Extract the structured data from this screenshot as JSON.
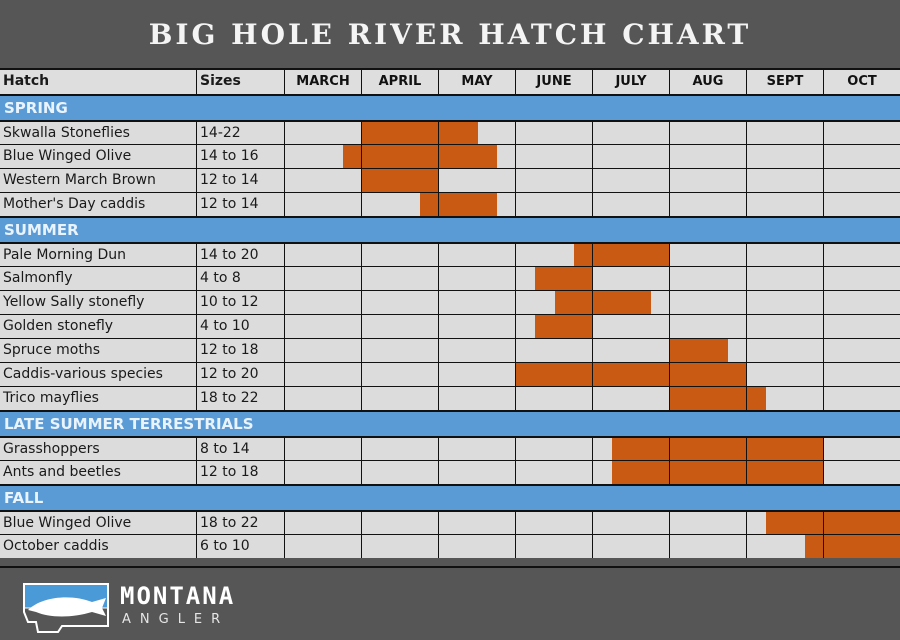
{
  "title": "BIG HOLE RIVER HATCH CHART",
  "headers": {
    "hatch": "Hatch",
    "sizes": "Sizes"
  },
  "brand": {
    "line1": "MONTANA",
    "line2": "ANGLER",
    "logo_icon": "montana-fish-logo"
  },
  "colors": {
    "bar": "#c85a13",
    "section": "#5b9bd5",
    "cell": "#dcdcdc",
    "background": "#565656"
  },
  "chart_data": {
    "type": "table",
    "title": "BIG HOLE RIVER HATCH CHART",
    "months": [
      "MARCH",
      "APRIL",
      "MAY",
      "JUNE",
      "JULY",
      "AUG",
      "SEPT",
      "OCT"
    ],
    "note": "Each hatch has an active period expressed as [start, end] in month units, where 0 = start of MARCH and 8 = end of OCT; quarter-month resolution.",
    "sections": [
      {
        "name": "SPRING",
        "hatches": [
          {
            "name": "Skwalla Stoneflies",
            "sizes": "14-22",
            "start": 1.0,
            "end": 2.5
          },
          {
            "name": "Blue Winged Olive",
            "sizes": "14 to 16",
            "start": 0.75,
            "end": 2.75
          },
          {
            "name": "Western March Brown",
            "sizes": "12 to 14",
            "start": 1.0,
            "end": 2.0
          },
          {
            "name": "Mother's Day caddis",
            "sizes": "12 to 14",
            "start": 1.75,
            "end": 2.75
          }
        ]
      },
      {
        "name": "SUMMER",
        "hatches": [
          {
            "name": "Pale Morning Dun",
            "sizes": "14 to 20",
            "start": 3.75,
            "end": 5.0
          },
          {
            "name": "Salmonfly",
            "sizes": "4 to 8",
            "start": 3.25,
            "end": 4.0
          },
          {
            "name": "Yellow Sally stonefly",
            "sizes": "10 to 12",
            "start": 3.5,
            "end": 4.75
          },
          {
            "name": "Golden stonefly",
            "sizes": "4 to 10",
            "start": 3.25,
            "end": 4.0
          },
          {
            "name": "Spruce moths",
            "sizes": "12 to 18",
            "start": 5.0,
            "end": 5.75
          },
          {
            "name": "Caddis-various species",
            "sizes": "12 to 20",
            "start": 3.0,
            "end": 6.0
          },
          {
            "name": "Trico mayflies",
            "sizes": "18 to 22",
            "start": 5.0,
            "end": 6.25
          }
        ]
      },
      {
        "name": "LATE SUMMER TERRESTRIALS",
        "hatches": [
          {
            "name": "Grasshoppers",
            "sizes": "8 to 14",
            "start": 4.25,
            "end": 7.0
          },
          {
            "name": "Ants and beetles",
            "sizes": "12 to 18",
            "start": 4.25,
            "end": 7.0
          }
        ]
      },
      {
        "name": "FALL",
        "hatches": [
          {
            "name": "Blue Winged Olive",
            "sizes": "18 to 22",
            "start": 6.25,
            "end": 8.0
          },
          {
            "name": "October caddis",
            "sizes": "6 to 10",
            "start": 6.75,
            "end": 8.0
          }
        ]
      }
    ]
  }
}
